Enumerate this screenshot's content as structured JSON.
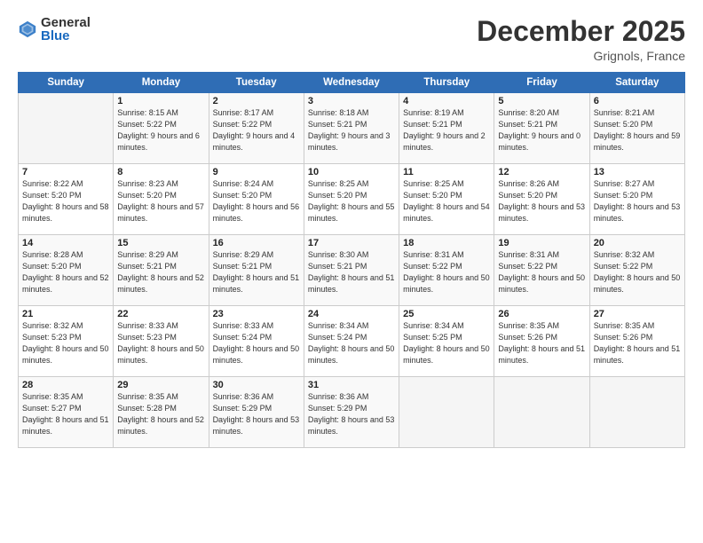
{
  "logo": {
    "general": "General",
    "blue": "Blue"
  },
  "title": "December 2025",
  "location": "Grignols, France",
  "days_of_week": [
    "Sunday",
    "Monday",
    "Tuesday",
    "Wednesday",
    "Thursday",
    "Friday",
    "Saturday"
  ],
  "weeks": [
    [
      {
        "num": "",
        "info": ""
      },
      {
        "num": "1",
        "info": "Sunrise: 8:15 AM\nSunset: 5:22 PM\nDaylight: 9 hours\nand 6 minutes."
      },
      {
        "num": "2",
        "info": "Sunrise: 8:17 AM\nSunset: 5:22 PM\nDaylight: 9 hours\nand 4 minutes."
      },
      {
        "num": "3",
        "info": "Sunrise: 8:18 AM\nSunset: 5:21 PM\nDaylight: 9 hours\nand 3 minutes."
      },
      {
        "num": "4",
        "info": "Sunrise: 8:19 AM\nSunset: 5:21 PM\nDaylight: 9 hours\nand 2 minutes."
      },
      {
        "num": "5",
        "info": "Sunrise: 8:20 AM\nSunset: 5:21 PM\nDaylight: 9 hours\nand 0 minutes."
      },
      {
        "num": "6",
        "info": "Sunrise: 8:21 AM\nSunset: 5:20 PM\nDaylight: 8 hours\nand 59 minutes."
      }
    ],
    [
      {
        "num": "7",
        "info": "Sunrise: 8:22 AM\nSunset: 5:20 PM\nDaylight: 8 hours\nand 58 minutes."
      },
      {
        "num": "8",
        "info": "Sunrise: 8:23 AM\nSunset: 5:20 PM\nDaylight: 8 hours\nand 57 minutes."
      },
      {
        "num": "9",
        "info": "Sunrise: 8:24 AM\nSunset: 5:20 PM\nDaylight: 8 hours\nand 56 minutes."
      },
      {
        "num": "10",
        "info": "Sunrise: 8:25 AM\nSunset: 5:20 PM\nDaylight: 8 hours\nand 55 minutes."
      },
      {
        "num": "11",
        "info": "Sunrise: 8:25 AM\nSunset: 5:20 PM\nDaylight: 8 hours\nand 54 minutes."
      },
      {
        "num": "12",
        "info": "Sunrise: 8:26 AM\nSunset: 5:20 PM\nDaylight: 8 hours\nand 53 minutes."
      },
      {
        "num": "13",
        "info": "Sunrise: 8:27 AM\nSunset: 5:20 PM\nDaylight: 8 hours\nand 53 minutes."
      }
    ],
    [
      {
        "num": "14",
        "info": "Sunrise: 8:28 AM\nSunset: 5:20 PM\nDaylight: 8 hours\nand 52 minutes."
      },
      {
        "num": "15",
        "info": "Sunrise: 8:29 AM\nSunset: 5:21 PM\nDaylight: 8 hours\nand 52 minutes."
      },
      {
        "num": "16",
        "info": "Sunrise: 8:29 AM\nSunset: 5:21 PM\nDaylight: 8 hours\nand 51 minutes."
      },
      {
        "num": "17",
        "info": "Sunrise: 8:30 AM\nSunset: 5:21 PM\nDaylight: 8 hours\nand 51 minutes."
      },
      {
        "num": "18",
        "info": "Sunrise: 8:31 AM\nSunset: 5:22 PM\nDaylight: 8 hours\nand 50 minutes."
      },
      {
        "num": "19",
        "info": "Sunrise: 8:31 AM\nSunset: 5:22 PM\nDaylight: 8 hours\nand 50 minutes."
      },
      {
        "num": "20",
        "info": "Sunrise: 8:32 AM\nSunset: 5:22 PM\nDaylight: 8 hours\nand 50 minutes."
      }
    ],
    [
      {
        "num": "21",
        "info": "Sunrise: 8:32 AM\nSunset: 5:23 PM\nDaylight: 8 hours\nand 50 minutes."
      },
      {
        "num": "22",
        "info": "Sunrise: 8:33 AM\nSunset: 5:23 PM\nDaylight: 8 hours\nand 50 minutes."
      },
      {
        "num": "23",
        "info": "Sunrise: 8:33 AM\nSunset: 5:24 PM\nDaylight: 8 hours\nand 50 minutes."
      },
      {
        "num": "24",
        "info": "Sunrise: 8:34 AM\nSunset: 5:24 PM\nDaylight: 8 hours\nand 50 minutes."
      },
      {
        "num": "25",
        "info": "Sunrise: 8:34 AM\nSunset: 5:25 PM\nDaylight: 8 hours\nand 50 minutes."
      },
      {
        "num": "26",
        "info": "Sunrise: 8:35 AM\nSunset: 5:26 PM\nDaylight: 8 hours\nand 51 minutes."
      },
      {
        "num": "27",
        "info": "Sunrise: 8:35 AM\nSunset: 5:26 PM\nDaylight: 8 hours\nand 51 minutes."
      }
    ],
    [
      {
        "num": "28",
        "info": "Sunrise: 8:35 AM\nSunset: 5:27 PM\nDaylight: 8 hours\nand 51 minutes."
      },
      {
        "num": "29",
        "info": "Sunrise: 8:35 AM\nSunset: 5:28 PM\nDaylight: 8 hours\nand 52 minutes."
      },
      {
        "num": "30",
        "info": "Sunrise: 8:36 AM\nSunset: 5:29 PM\nDaylight: 8 hours\nand 53 minutes."
      },
      {
        "num": "31",
        "info": "Sunrise: 8:36 AM\nSunset: 5:29 PM\nDaylight: 8 hours\nand 53 minutes."
      },
      {
        "num": "",
        "info": ""
      },
      {
        "num": "",
        "info": ""
      },
      {
        "num": "",
        "info": ""
      }
    ]
  ]
}
